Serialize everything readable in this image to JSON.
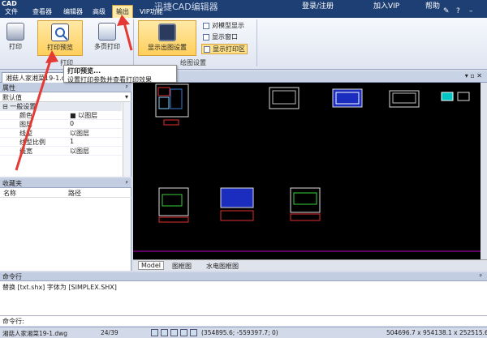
{
  "menu": {
    "logo": "CAD",
    "items": [
      "文件",
      "查看器",
      "编辑器",
      "高级",
      "输出",
      "VIP功能"
    ],
    "title": "迅捷CAD编辑器",
    "right": [
      "登录/注册",
      "加入VIP",
      "帮助"
    ]
  },
  "ribbon": {
    "print": "打印",
    "print_preview": "打印预览",
    "multi_print": "多页打印",
    "group_print": "打印",
    "show_drawing_settings": "显示出图设置",
    "opt_model_display": "对模型显示",
    "opt_show_window": "显示窗口",
    "opt_show_print_area": "显示打印区",
    "group_drawing": "绘图设置"
  },
  "tooltip": {
    "title": "打印预览...",
    "desc": "设置打印参数并查看打印效果"
  },
  "document": {
    "tab": "湘菇人家湘菜19-1.dwg"
  },
  "properties": {
    "header": "属性",
    "selector": "默认值",
    "section": "一般设置",
    "rows": [
      {
        "key": "颜色",
        "value": "■ 以图层"
      },
      {
        "key": "图层",
        "value": "0"
      },
      {
        "key": "线型",
        "value": "以图层"
      },
      {
        "key": "线型比例",
        "value": "1"
      },
      {
        "key": "线宽",
        "value": "以图层"
      }
    ]
  },
  "favorites": {
    "header": "收藏夹",
    "col_name": "名称",
    "col_path": "路径"
  },
  "layout_tabs": [
    "Model",
    "图框图",
    "水电图框图"
  ],
  "command": {
    "header": "命令行",
    "output": "替换 [txt.shx] 字体为 [SIMPLEX.SHX]",
    "prompt": "命令行:"
  },
  "status": {
    "file": "湘菇人家湘菜19-1.dwg",
    "page": "24/39",
    "coords": "(354895.6; -559397.7; 0)",
    "extent": "504696.7 x 954138.1 x 252515.6"
  },
  "colors": {
    "accent": "#ffcf5c",
    "titlebar": "#1d3f73",
    "annotation": "#e53935"
  }
}
